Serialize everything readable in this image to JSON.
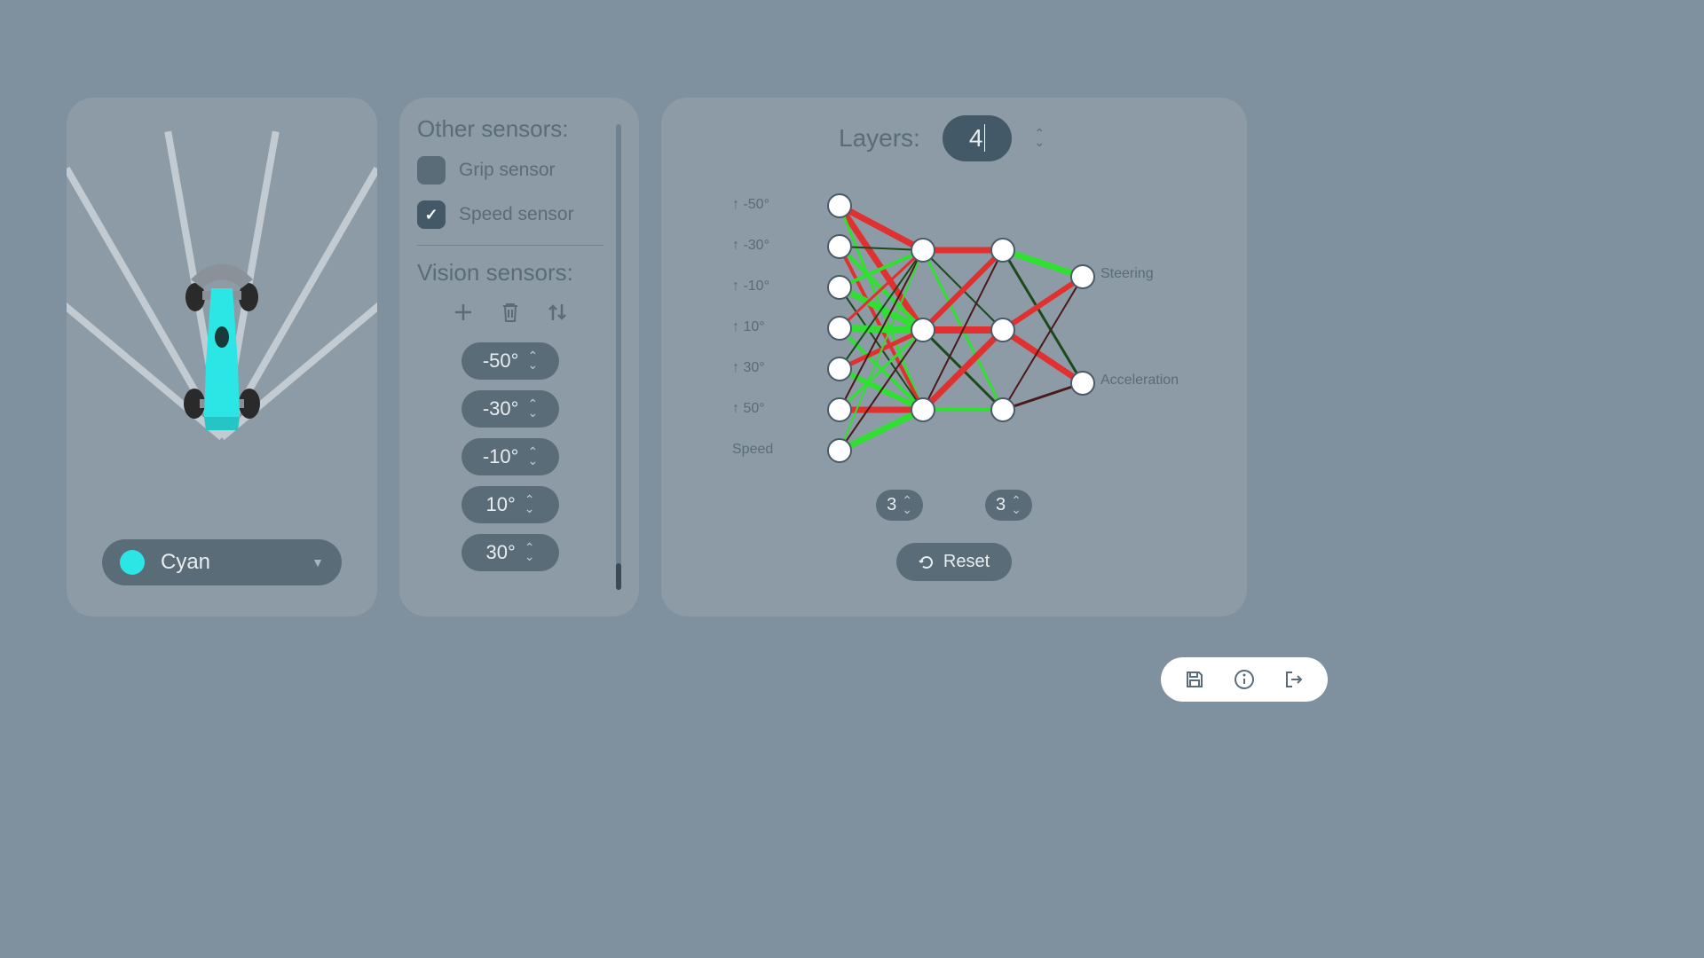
{
  "car": {
    "color_name": "Cyan",
    "color_hex": "#2ce5e5",
    "sensor_rays": [
      -50,
      -30,
      -10,
      10,
      30,
      50
    ]
  },
  "sensors": {
    "other_title": "Other sensors:",
    "vision_title": "Vision sensors:",
    "grip": {
      "label": "Grip sensor",
      "checked": false
    },
    "speed": {
      "label": "Speed sensor",
      "checked": true
    },
    "angles": [
      "-50°",
      "-30°",
      "-10°",
      "10°",
      "30°"
    ]
  },
  "network": {
    "layers_label": "Layers:",
    "layers_value": "4",
    "input_labels": [
      "↑ -50°",
      "↑ -30°",
      "↑ -10°",
      "↑ 10°",
      "↑ 30°",
      "↑ 50°",
      "Speed"
    ],
    "output_labels": [
      "Steering",
      "Acceleration"
    ],
    "hidden_counts": [
      "3",
      "3"
    ],
    "reset_label": "Reset"
  }
}
